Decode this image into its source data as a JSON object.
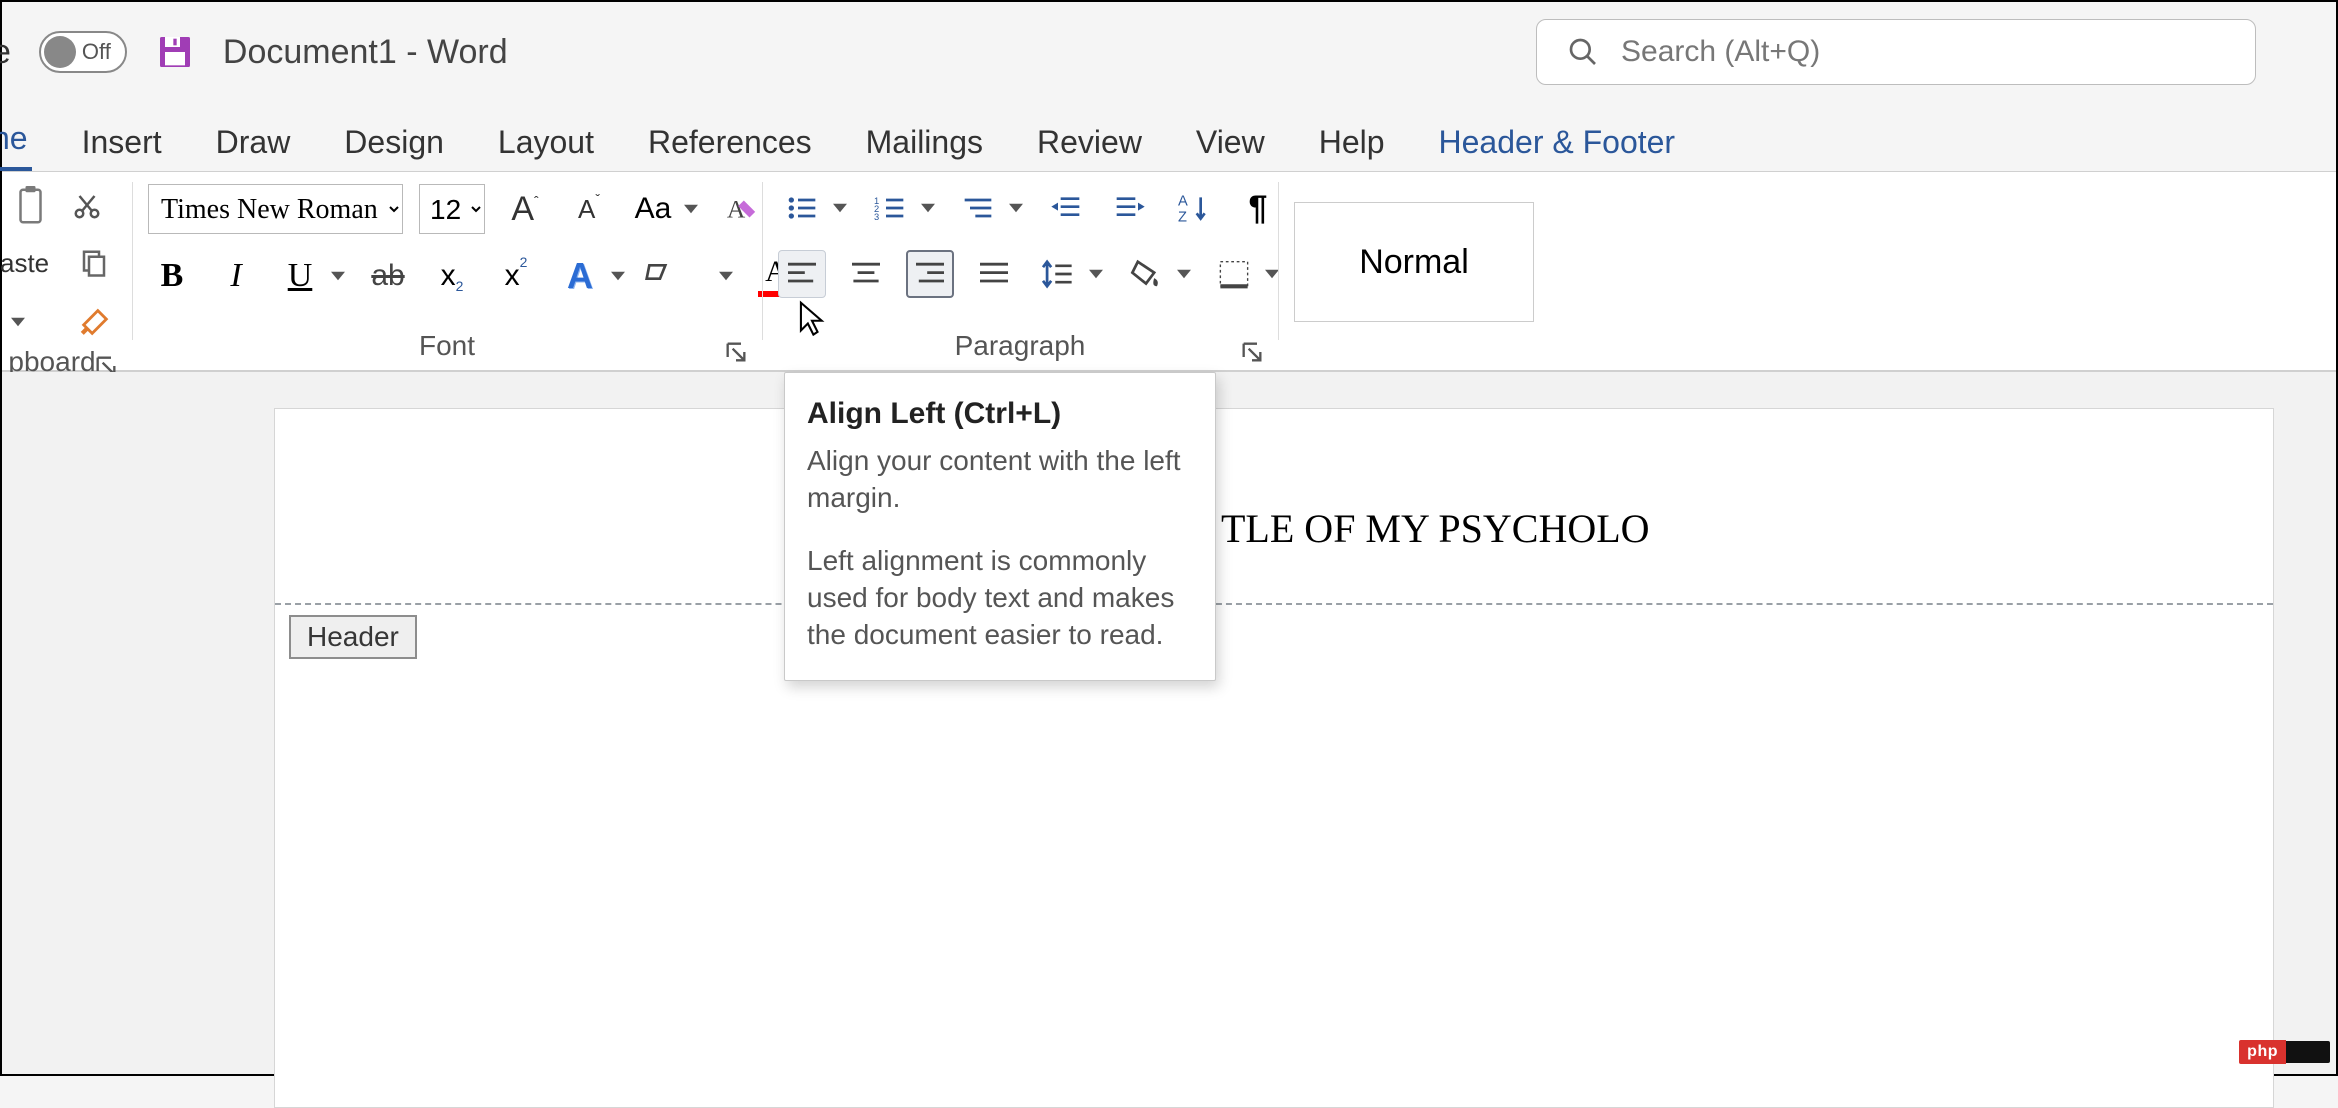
{
  "titlebar": {
    "autosave_partial_label": "e",
    "autosave_state": "Off",
    "document_title": "Document1  -  Word"
  },
  "search": {
    "placeholder": "Search (Alt+Q)"
  },
  "tabs": {
    "active_partial": "ne",
    "items": [
      "Insert",
      "Draw",
      "Design",
      "Layout",
      "References",
      "Mailings",
      "Review",
      "View",
      "Help"
    ],
    "contextual": "Header & Footer"
  },
  "ribbon": {
    "clipboard": {
      "label": "pboard",
      "paste_partial": "aste"
    },
    "font": {
      "label": "Font",
      "name": "Times New Roman",
      "size": "12",
      "change_case": "Aa",
      "bold": "B",
      "italic": "I",
      "underline": "U",
      "strike": "ab",
      "sub": "x",
      "sup": "x",
      "text_effect": "A",
      "highlight": "#ffff00",
      "font_color": "#ff0000"
    },
    "paragraph": {
      "label": "Paragraph"
    },
    "styles": {
      "normal": "Normal"
    }
  },
  "tooltip": {
    "title": "Align Left (Ctrl+L)",
    "desc1": "Align your content with the left margin.",
    "desc2": "Left alignment is commonly used for body text and makes the document easier to read."
  },
  "document": {
    "header_label": "Header",
    "title_fragment": "TLE OF MY PSYCHOLO"
  },
  "watermark": {
    "left": "php"
  }
}
